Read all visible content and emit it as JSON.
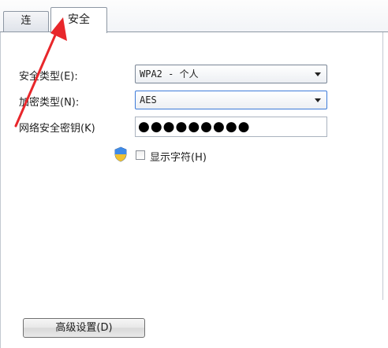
{
  "tabs": {
    "inactive_label": "连",
    "active_label": "安全"
  },
  "security": {
    "type_label": "安全类型(E):",
    "type_value": "WPA2 - 个人",
    "encryption_label": "加密类型(N):",
    "encryption_value": "AES",
    "key_label": "网络安全密钥(K)",
    "key_value": "●●●●●●●●●",
    "show_chars_label": "显示字符(H)",
    "show_chars_checked": false
  },
  "footer": {
    "advanced_button": "高级设置(D)"
  },
  "colors": {
    "annotation_arrow": "#e8272b",
    "focus_border": "#3d7bd9"
  }
}
